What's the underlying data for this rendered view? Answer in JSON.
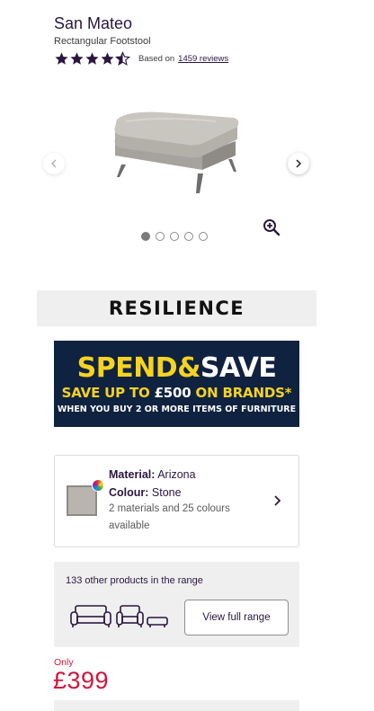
{
  "product": {
    "title": "San Mateo",
    "subtitle": "Rectangular Footstool",
    "rating": 4.5,
    "rating_prefix": "Based on",
    "reviews_link": "1459 reviews",
    "star_color": "#2a1740"
  },
  "gallery": {
    "slide_count": 5,
    "active_slide": 1,
    "prev_icon": "chevron-left-icon",
    "next_icon": "chevron-right-icon",
    "zoom_icon": "zoom-in-icon"
  },
  "brand": {
    "name": "RESILIENCE"
  },
  "promo": {
    "line1_a": "SPEND",
    "line1_amp": "&",
    "line1_b": "SAVE",
    "line2_a": "SAVE UP TO",
    "line2_amount": "£500",
    "line2_b": "ON BRANDS*",
    "line3": "WHEN YOU BUY 2 OR MORE ITEMS OF FURNITURE",
    "bg_color": "#0f2240",
    "accent_color": "#f5d320"
  },
  "material": {
    "material_label": "Material:",
    "material_value": "Arizona",
    "colour_label": "Colour:",
    "colour_value": "Stone",
    "options_line1": "2 materials and 25 colours",
    "options_line2": "available",
    "swatch_color": "#b9b5ae"
  },
  "range": {
    "count_text": "133 other products in the range",
    "button_label": "View full range"
  },
  "price": {
    "prefix": "Only",
    "value": "£399",
    "color": "#d4153c"
  }
}
